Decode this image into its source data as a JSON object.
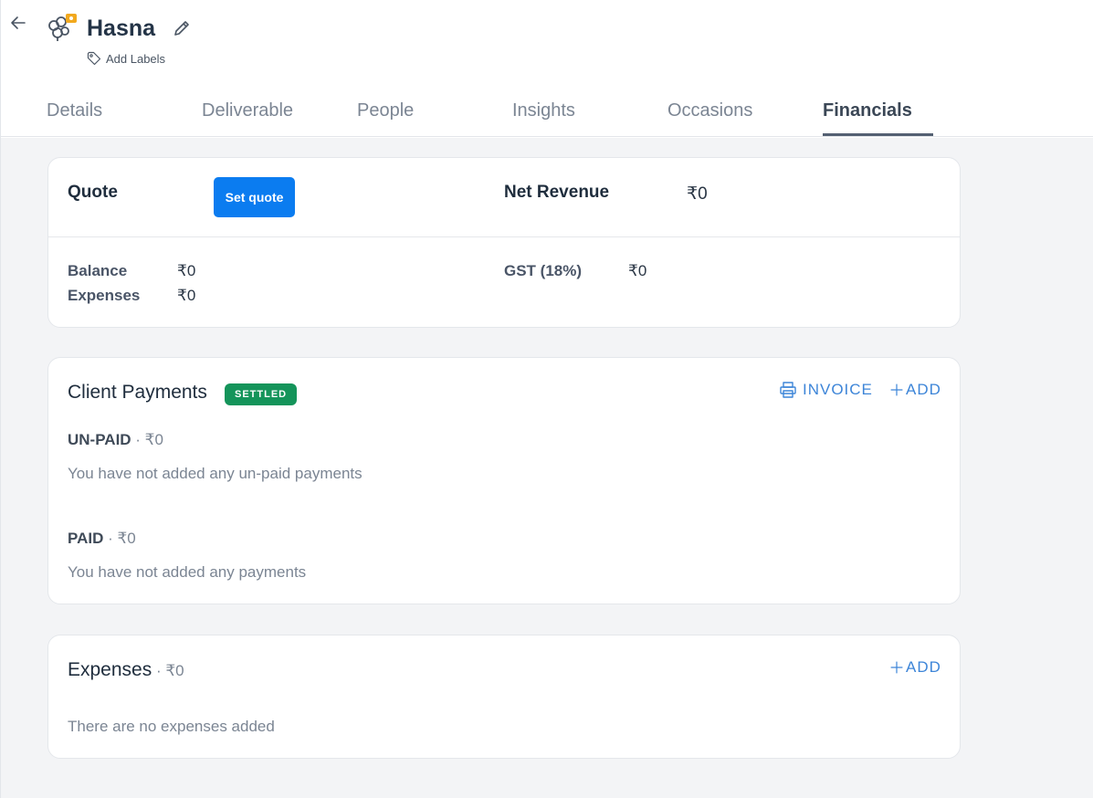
{
  "header": {
    "title": "Hasna",
    "add_labels": "Add Labels"
  },
  "tabs": [
    {
      "label": "Details"
    },
    {
      "label": "Deliverable"
    },
    {
      "label": "People"
    },
    {
      "label": "Insights"
    },
    {
      "label": "Occasions"
    },
    {
      "label": "Financials"
    }
  ],
  "active_tab": "Financials",
  "summary": {
    "quote_label": "Quote",
    "set_quote_button": "Set quote",
    "net_revenue_label": "Net Revenue",
    "net_revenue_value": "₹0",
    "balance_label": "Balance",
    "balance_value": "₹0",
    "expenses_label": "Expenses",
    "expenses_value": "₹0",
    "gst_label": "GST (18%)",
    "gst_value": "₹0"
  },
  "client_payments": {
    "title": "Client Payments",
    "status_badge": "SETTLED",
    "invoice_label": "INVOICE",
    "add_label": "ADD",
    "unpaid_label": "UN-PAID",
    "unpaid_amount": " · ₹0",
    "unpaid_empty": "You have not added any un-paid payments",
    "paid_label": "PAID",
    "paid_amount": " · ₹0",
    "paid_empty": "You have not added any payments"
  },
  "expenses": {
    "title": "Expenses",
    "amount": " · ₹0",
    "add_label": "ADD",
    "empty": "There are no expenses added"
  },
  "colors": {
    "primary": "#0b7cf0",
    "link": "#3d85d8",
    "badge": "#14945a",
    "background": "#f3f4f6"
  }
}
